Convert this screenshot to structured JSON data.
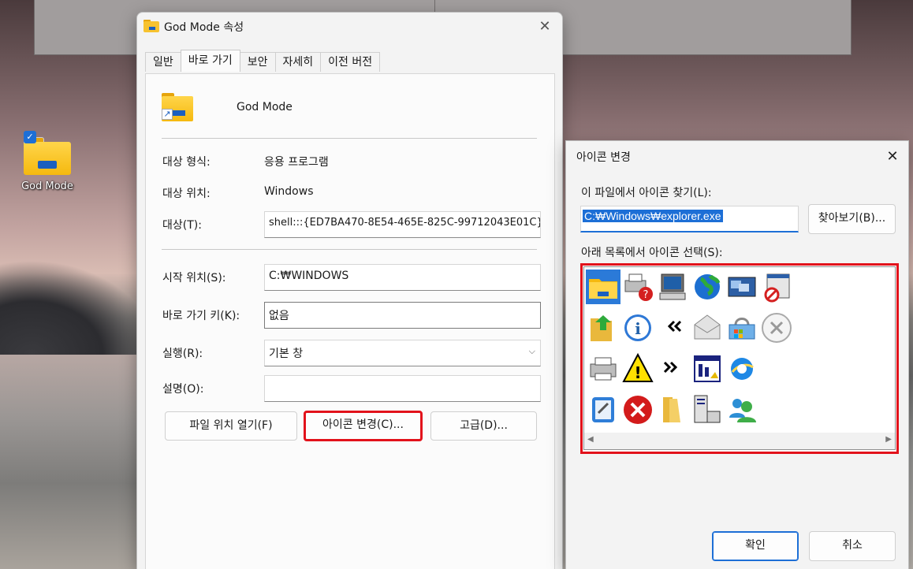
{
  "desktop": {
    "icon_label": "God Mode"
  },
  "properties_dialog": {
    "title": "God Mode 속성",
    "tabs": [
      "일반",
      "바로 가기",
      "보안",
      "자세히",
      "이전 버전"
    ],
    "active_tab": "바로 가기",
    "app_name": "God Mode",
    "target_type_label": "대상 형식:",
    "target_type_value": "응용 프로그램",
    "target_location_label": "대상 위치:",
    "target_location_value": "Windows",
    "target_label": "대상(T):",
    "target_value": "shell:::{ED7BA470-8E54-465E-825C-99712043E01C}",
    "start_in_label": "시작 위치(S):",
    "start_in_value": "C:₩WINDOWS",
    "shortcut_key_label": "바로 가기 키(K):",
    "shortcut_key_value": "없음",
    "run_label": "실행(R):",
    "run_value": "기본 창",
    "comment_label": "설명(O):",
    "comment_value": "",
    "buttons": {
      "open_location": "파일 위치 열기(F)",
      "change_icon": "아이콘 변경(C)...",
      "advanced": "고급(D)..."
    }
  },
  "change_icon_dialog": {
    "title": "아이콘 변경",
    "look_for_label": "이 파일에서 아이콘 찾기(L):",
    "file_path": "C:₩Windows₩explorer.exe",
    "browse_button": "찾아보기(B)...",
    "select_label": "아래 목록에서 아이콘 선택(S):",
    "icons": [
      "folder-icon",
      "printer-help-icon",
      "computer-icon",
      "globe-icon",
      "windows-stack-icon",
      "blocked-window-icon",
      "folder-up-icon",
      "info-icon",
      "double-chevron-left-icon",
      "envelope-icon",
      "shopping-basket-icon",
      "cancel-circle-icon",
      "printer-icon",
      "warning-icon",
      "double-chevron-right-icon",
      "window-chart-icon",
      "internet-explorer-icon",
      "notepad-icon",
      "error-icon",
      "folder-open-icon",
      "server-icon",
      "users-icon"
    ],
    "selected_icon": "folder-icon",
    "ok_button": "확인",
    "cancel_button": "취소"
  },
  "colors": {
    "accent": "#1d6fd6",
    "highlight_border": "#e2121b",
    "folder_yellow": "#f5b90f"
  }
}
